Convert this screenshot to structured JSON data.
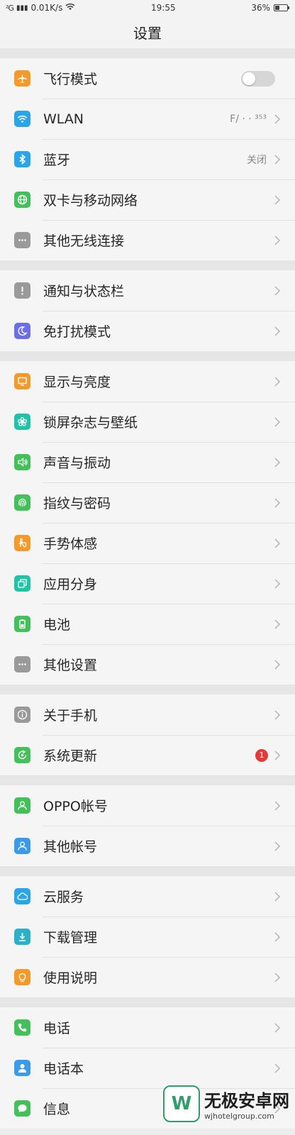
{
  "status": {
    "signal": "²G",
    "speed": "0.01K/s",
    "time": "19:55",
    "battery": "36%",
    "battery_level": 0.36
  },
  "title": "设置",
  "groups": [
    [
      {
        "label": "飞行模式",
        "icon": "airplane-icon",
        "color": "#f39a2b",
        "accessory": "toggle"
      },
      {
        "label": "WLAN",
        "icon": "wifi-icon",
        "color": "#2aa6e8",
        "value": "F/ ·   ·  ³⁵³"
      },
      {
        "label": "蓝牙",
        "icon": "bluetooth-icon",
        "color": "#2aa6e8",
        "value": "关闭"
      },
      {
        "label": "双卡与移动网络",
        "icon": "globe-icon",
        "color": "#43c05a"
      },
      {
        "label": "其他无线连接",
        "icon": "more-icon",
        "color": "#9a9a9a"
      }
    ],
    [
      {
        "label": "通知与状态栏",
        "icon": "exclamation-icon",
        "color": "#9a9a9a"
      },
      {
        "label": "免打扰模式",
        "icon": "moon-icon",
        "color": "#6c6ee8"
      }
    ],
    [
      {
        "label": "显示与亮度",
        "icon": "monitor-icon",
        "color": "#f39a2b"
      },
      {
        "label": "锁屏杂志与壁纸",
        "icon": "flower-icon",
        "color": "#20c3a7"
      },
      {
        "label": "声音与振动",
        "icon": "speaker-icon",
        "color": "#43c05a"
      },
      {
        "label": "指纹与密码",
        "icon": "fingerprint-icon",
        "color": "#43c05a"
      },
      {
        "label": "手势体感",
        "icon": "hand-icon",
        "color": "#f39a2b"
      },
      {
        "label": "应用分身",
        "icon": "clone-icon",
        "color": "#20c3a7"
      },
      {
        "label": "电池",
        "icon": "battery-icon",
        "color": "#43c05a"
      },
      {
        "label": "其他设置",
        "icon": "more-icon",
        "color": "#9a9a9a"
      }
    ],
    [
      {
        "label": "关于手机",
        "icon": "info-icon",
        "color": "#9a9a9a"
      },
      {
        "label": "系统更新",
        "icon": "update-icon",
        "color": "#43c05a",
        "badge": "1"
      }
    ],
    [
      {
        "label": "OPPO帐号",
        "icon": "user-icon",
        "color": "#43c05a"
      },
      {
        "label": "其他帐号",
        "icon": "user-icon",
        "color": "#3a9be8"
      }
    ],
    [
      {
        "label": "云服务",
        "icon": "cloud-icon",
        "color": "#2aa6e8"
      },
      {
        "label": "下载管理",
        "icon": "download-icon",
        "color": "#2ab0c9"
      },
      {
        "label": "使用说明",
        "icon": "bulb-icon",
        "color": "#f39a2b"
      }
    ],
    [
      {
        "label": "电话",
        "icon": "phone-icon",
        "color": "#43c05a"
      },
      {
        "label": "电话本",
        "icon": "contact-icon",
        "color": "#3a9be8"
      },
      {
        "label": "信息",
        "icon": "message-icon",
        "color": "#43c05a"
      }
    ]
  ],
  "watermark": {
    "logo_letter": "W",
    "name": "无极安卓网",
    "site": "wjhotelgroup.com"
  }
}
